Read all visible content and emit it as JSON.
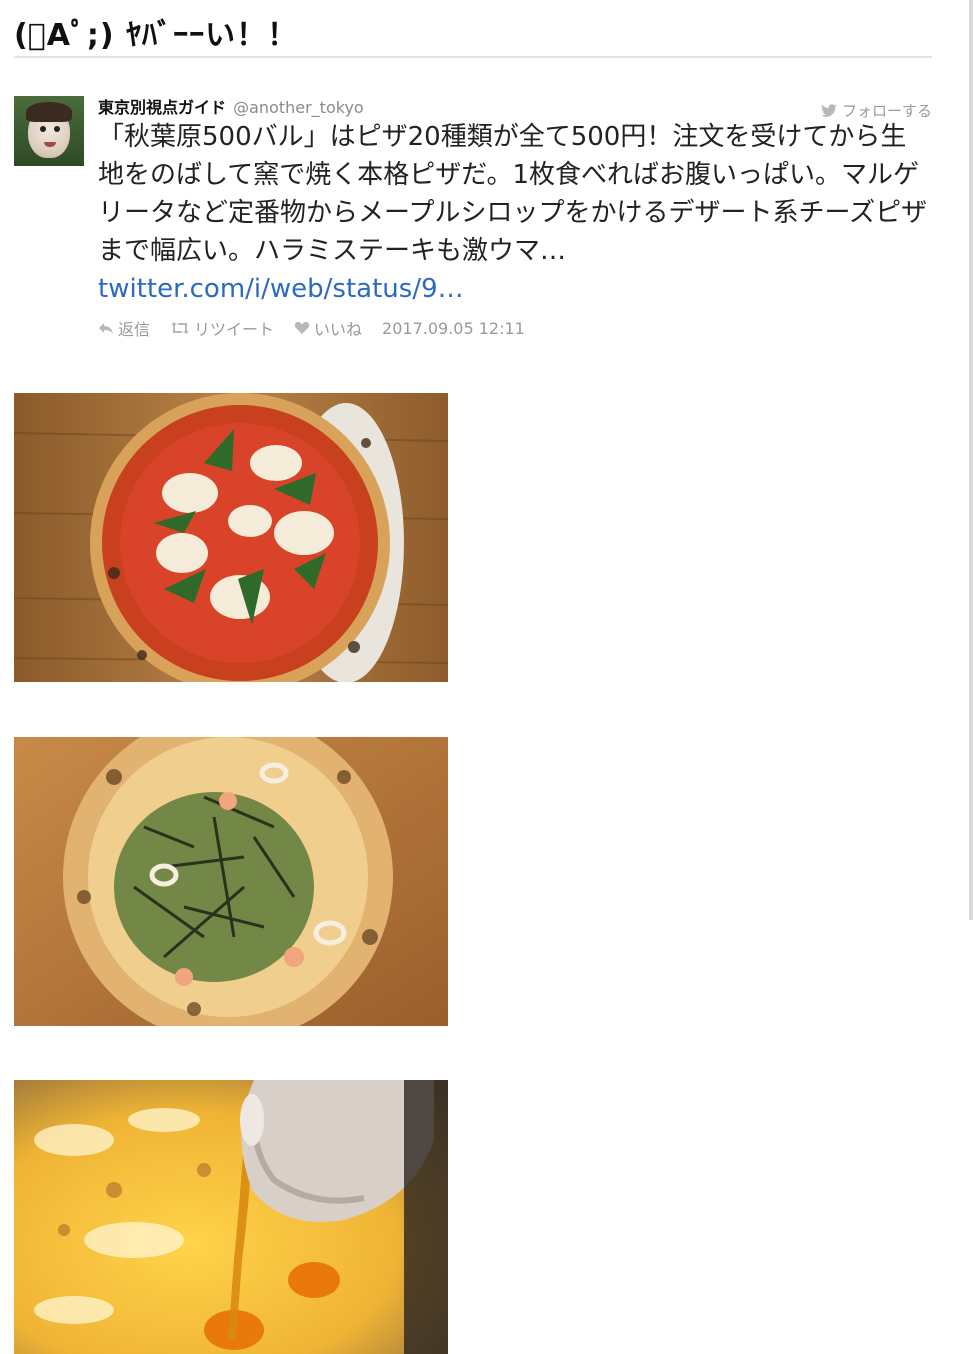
{
  "page": {
    "title": "(ﾟАﾟ;) ﾔﾊﾞｰｰい！！"
  },
  "tweet": {
    "author_name": "東京別視点ガイド",
    "author_handle": "@another_tokyo",
    "follow_label": "フォローする",
    "text": "「秋葉原500バル」はピザ20種類が全て500円！注文を受けてから生地をのばして窯で焼く本格ピザだ。1枚食べればお腹いっぱい。マルゲリータなど定番物からメープルシロップをかけるデザート系チーズピザまで幅広い。ハラミステーキも激ウマ…",
    "link_text": "twitter.com/i/web/status/9…",
    "actions": {
      "reply": "返信",
      "retweet": "リツイート",
      "like": "いいね"
    },
    "timestamp": "2017.09.05 12:11"
  },
  "colors": {
    "link": "#2a6bbf",
    "muted": "#9a9a9a",
    "wood": "#b07a3e",
    "tomato": "#d9432a"
  },
  "icons": [
    "twitter-bird-icon",
    "reply-icon",
    "retweet-icon",
    "heart-icon"
  ]
}
